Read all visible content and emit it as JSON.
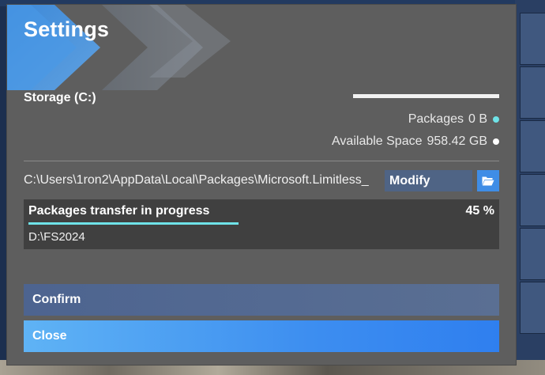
{
  "dialog": {
    "title": "Settings"
  },
  "storage": {
    "label": "Storage (C:)",
    "packages_label": "Packages",
    "packages_value": "0 B",
    "packages_color": "#6fe3e8",
    "available_label": "Available Space",
    "available_value": "958.42 GB",
    "available_color": "#ffffff",
    "used_fraction": 0
  },
  "install_path": {
    "path": "C:\\Users\\1ron2\\AppData\\Local\\Packages\\Microsoft.Limitless_",
    "modify_label": "Modify",
    "folder_icon": "folder-open-icon"
  },
  "transfer": {
    "title": "Packages transfer in progress",
    "percent_label": "45 %",
    "progress": 0.45,
    "destination": "D:\\FS2024",
    "progress_color": "#6fe3e8"
  },
  "buttons": {
    "confirm_label": "Confirm",
    "close_label": "Close"
  }
}
